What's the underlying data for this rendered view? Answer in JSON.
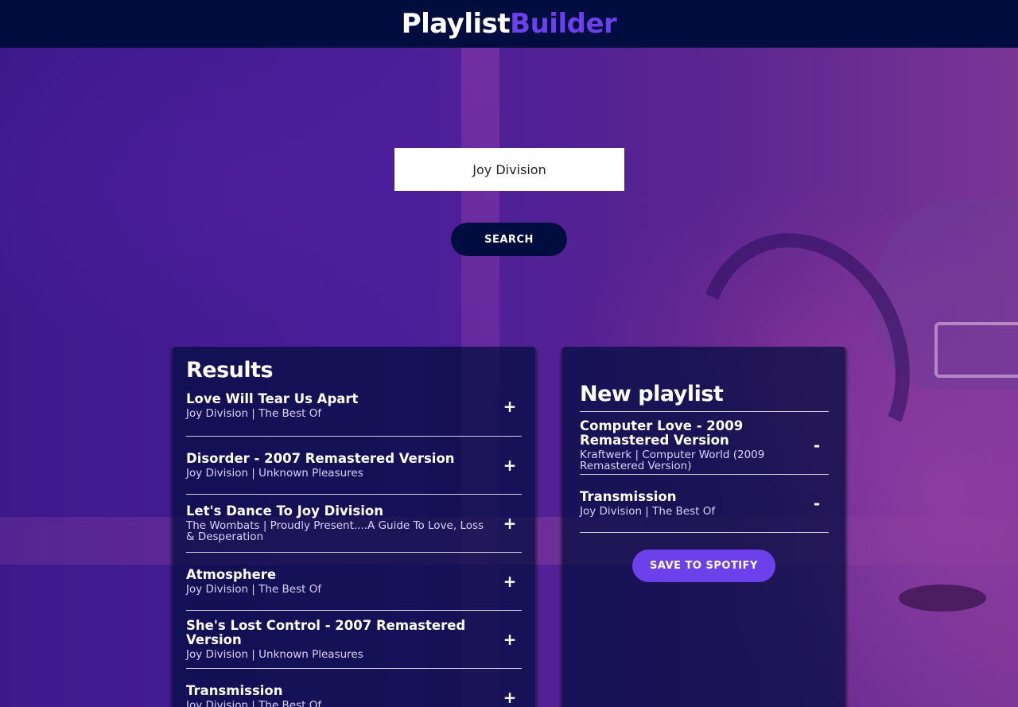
{
  "header": {
    "logo_part1": "Playlist",
    "logo_part2": "Builder"
  },
  "search": {
    "value": "Joy Division",
    "button_label": "SEARCH"
  },
  "results": {
    "title": "Results",
    "action_symbol": "+",
    "tracks": [
      {
        "name": "Love Will Tear Us Apart",
        "meta": "Joy Division | The Best Of"
      },
      {
        "name": "Disorder - 2007 Remastered Version",
        "meta": "Joy Division | Unknown Pleasures"
      },
      {
        "name": "Let's Dance To Joy Division",
        "meta": "The Wombats | Proudly Present....A Guide To Love, Loss & Desperation"
      },
      {
        "name": "Atmosphere",
        "meta": "Joy Division | The Best Of"
      },
      {
        "name": "She's Lost Control - 2007 Remastered Version",
        "meta": "Joy Division | Unknown Pleasures"
      },
      {
        "name": "Transmission",
        "meta": "Joy Division | The Best Of"
      }
    ]
  },
  "playlist": {
    "title": "New playlist",
    "action_symbol": "-",
    "tracks": [
      {
        "name": "Computer Love - 2009 Remastered Version",
        "meta": "Kraftwerk | Computer World (2009 Remastered Version)"
      },
      {
        "name": "Transmission",
        "meta": "Joy Division | The Best Of"
      }
    ],
    "save_label": "SAVE TO SPOTIFY"
  },
  "colors": {
    "navy": "#010c3f",
    "accent": "#6c41ec",
    "input_bg": "#ffffff"
  }
}
